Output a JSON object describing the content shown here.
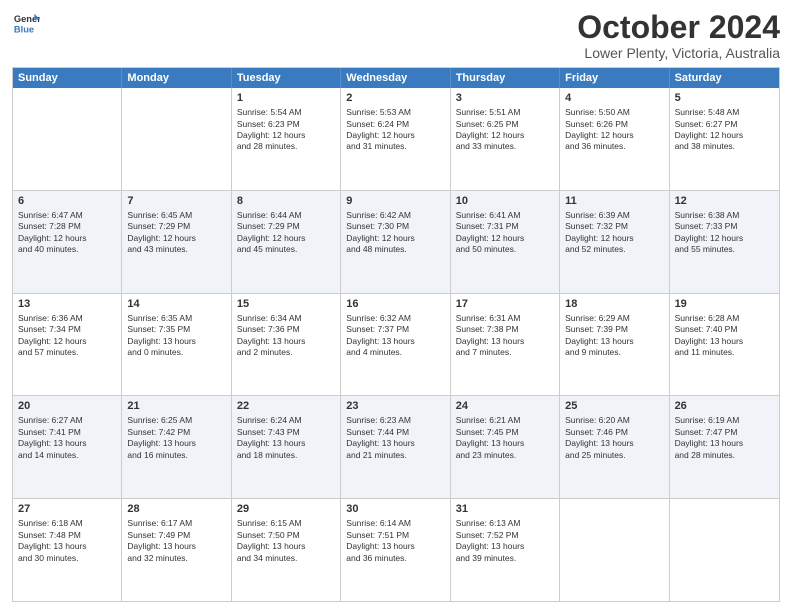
{
  "header": {
    "logo_line1": "General",
    "logo_line2": "Blue",
    "main_title": "October 2024",
    "subtitle": "Lower Plenty, Victoria, Australia"
  },
  "days_of_week": [
    "Sunday",
    "Monday",
    "Tuesday",
    "Wednesday",
    "Thursday",
    "Friday",
    "Saturday"
  ],
  "weeks": [
    {
      "alt": false,
      "cells": [
        {
          "day": "",
          "lines": []
        },
        {
          "day": "",
          "lines": []
        },
        {
          "day": "1",
          "lines": [
            "Sunrise: 5:54 AM",
            "Sunset: 6:23 PM",
            "Daylight: 12 hours",
            "and 28 minutes."
          ]
        },
        {
          "day": "2",
          "lines": [
            "Sunrise: 5:53 AM",
            "Sunset: 6:24 PM",
            "Daylight: 12 hours",
            "and 31 minutes."
          ]
        },
        {
          "day": "3",
          "lines": [
            "Sunrise: 5:51 AM",
            "Sunset: 6:25 PM",
            "Daylight: 12 hours",
            "and 33 minutes."
          ]
        },
        {
          "day": "4",
          "lines": [
            "Sunrise: 5:50 AM",
            "Sunset: 6:26 PM",
            "Daylight: 12 hours",
            "and 36 minutes."
          ]
        },
        {
          "day": "5",
          "lines": [
            "Sunrise: 5:48 AM",
            "Sunset: 6:27 PM",
            "Daylight: 12 hours",
            "and 38 minutes."
          ]
        }
      ]
    },
    {
      "alt": true,
      "cells": [
        {
          "day": "6",
          "lines": [
            "Sunrise: 6:47 AM",
            "Sunset: 7:28 PM",
            "Daylight: 12 hours",
            "and 40 minutes."
          ]
        },
        {
          "day": "7",
          "lines": [
            "Sunrise: 6:45 AM",
            "Sunset: 7:29 PM",
            "Daylight: 12 hours",
            "and 43 minutes."
          ]
        },
        {
          "day": "8",
          "lines": [
            "Sunrise: 6:44 AM",
            "Sunset: 7:29 PM",
            "Daylight: 12 hours",
            "and 45 minutes."
          ]
        },
        {
          "day": "9",
          "lines": [
            "Sunrise: 6:42 AM",
            "Sunset: 7:30 PM",
            "Daylight: 12 hours",
            "and 48 minutes."
          ]
        },
        {
          "day": "10",
          "lines": [
            "Sunrise: 6:41 AM",
            "Sunset: 7:31 PM",
            "Daylight: 12 hours",
            "and 50 minutes."
          ]
        },
        {
          "day": "11",
          "lines": [
            "Sunrise: 6:39 AM",
            "Sunset: 7:32 PM",
            "Daylight: 12 hours",
            "and 52 minutes."
          ]
        },
        {
          "day": "12",
          "lines": [
            "Sunrise: 6:38 AM",
            "Sunset: 7:33 PM",
            "Daylight: 12 hours",
            "and 55 minutes."
          ]
        }
      ]
    },
    {
      "alt": false,
      "cells": [
        {
          "day": "13",
          "lines": [
            "Sunrise: 6:36 AM",
            "Sunset: 7:34 PM",
            "Daylight: 12 hours",
            "and 57 minutes."
          ]
        },
        {
          "day": "14",
          "lines": [
            "Sunrise: 6:35 AM",
            "Sunset: 7:35 PM",
            "Daylight: 13 hours",
            "and 0 minutes."
          ]
        },
        {
          "day": "15",
          "lines": [
            "Sunrise: 6:34 AM",
            "Sunset: 7:36 PM",
            "Daylight: 13 hours",
            "and 2 minutes."
          ]
        },
        {
          "day": "16",
          "lines": [
            "Sunrise: 6:32 AM",
            "Sunset: 7:37 PM",
            "Daylight: 13 hours",
            "and 4 minutes."
          ]
        },
        {
          "day": "17",
          "lines": [
            "Sunrise: 6:31 AM",
            "Sunset: 7:38 PM",
            "Daylight: 13 hours",
            "and 7 minutes."
          ]
        },
        {
          "day": "18",
          "lines": [
            "Sunrise: 6:29 AM",
            "Sunset: 7:39 PM",
            "Daylight: 13 hours",
            "and 9 minutes."
          ]
        },
        {
          "day": "19",
          "lines": [
            "Sunrise: 6:28 AM",
            "Sunset: 7:40 PM",
            "Daylight: 13 hours",
            "and 11 minutes."
          ]
        }
      ]
    },
    {
      "alt": true,
      "cells": [
        {
          "day": "20",
          "lines": [
            "Sunrise: 6:27 AM",
            "Sunset: 7:41 PM",
            "Daylight: 13 hours",
            "and 14 minutes."
          ]
        },
        {
          "day": "21",
          "lines": [
            "Sunrise: 6:25 AM",
            "Sunset: 7:42 PM",
            "Daylight: 13 hours",
            "and 16 minutes."
          ]
        },
        {
          "day": "22",
          "lines": [
            "Sunrise: 6:24 AM",
            "Sunset: 7:43 PM",
            "Daylight: 13 hours",
            "and 18 minutes."
          ]
        },
        {
          "day": "23",
          "lines": [
            "Sunrise: 6:23 AM",
            "Sunset: 7:44 PM",
            "Daylight: 13 hours",
            "and 21 minutes."
          ]
        },
        {
          "day": "24",
          "lines": [
            "Sunrise: 6:21 AM",
            "Sunset: 7:45 PM",
            "Daylight: 13 hours",
            "and 23 minutes."
          ]
        },
        {
          "day": "25",
          "lines": [
            "Sunrise: 6:20 AM",
            "Sunset: 7:46 PM",
            "Daylight: 13 hours",
            "and 25 minutes."
          ]
        },
        {
          "day": "26",
          "lines": [
            "Sunrise: 6:19 AM",
            "Sunset: 7:47 PM",
            "Daylight: 13 hours",
            "and 28 minutes."
          ]
        }
      ]
    },
    {
      "alt": false,
      "cells": [
        {
          "day": "27",
          "lines": [
            "Sunrise: 6:18 AM",
            "Sunset: 7:48 PM",
            "Daylight: 13 hours",
            "and 30 minutes."
          ]
        },
        {
          "day": "28",
          "lines": [
            "Sunrise: 6:17 AM",
            "Sunset: 7:49 PM",
            "Daylight: 13 hours",
            "and 32 minutes."
          ]
        },
        {
          "day": "29",
          "lines": [
            "Sunrise: 6:15 AM",
            "Sunset: 7:50 PM",
            "Daylight: 13 hours",
            "and 34 minutes."
          ]
        },
        {
          "day": "30",
          "lines": [
            "Sunrise: 6:14 AM",
            "Sunset: 7:51 PM",
            "Daylight: 13 hours",
            "and 36 minutes."
          ]
        },
        {
          "day": "31",
          "lines": [
            "Sunrise: 6:13 AM",
            "Sunset: 7:52 PM",
            "Daylight: 13 hours",
            "and 39 minutes."
          ]
        },
        {
          "day": "",
          "lines": []
        },
        {
          "day": "",
          "lines": []
        }
      ]
    }
  ]
}
